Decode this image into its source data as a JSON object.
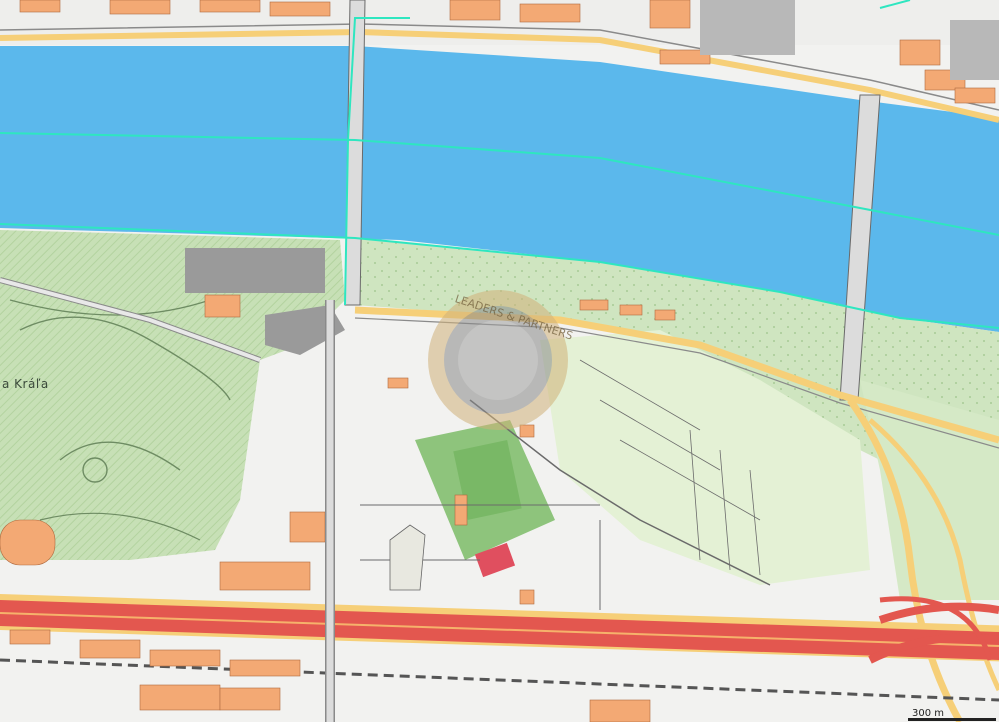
{
  "map": {
    "park_label": "a Kráľa",
    "scale_label": "300 m",
    "watermark_text": "LEADERS & PARTNERS",
    "colors": {
      "water": "#5bb8ec",
      "park": "#cfe5c0",
      "park_dense": "#b9d8a8",
      "meadow": "#e4f1d5",
      "building": "#f3a974",
      "road_main": "#e3574f",
      "road_secondary": "#f6cf78",
      "boundary": "#2ee6c0",
      "urban": "#f2f2f0"
    }
  }
}
